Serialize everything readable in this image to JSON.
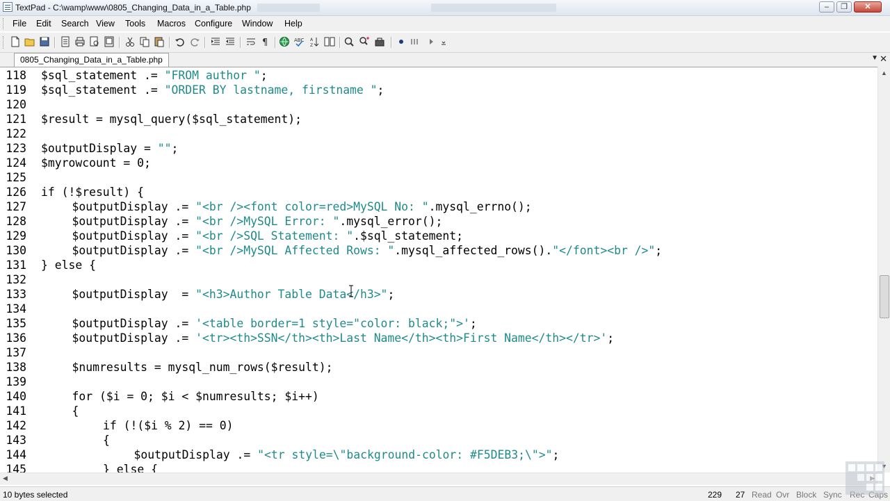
{
  "window": {
    "title": "TextPad - C:\\wamp\\www\\0805_Changing_Data_in_a_Table.php",
    "controls": [
      "minimize",
      "restore",
      "close"
    ]
  },
  "menu": [
    "File",
    "Edit",
    "Search",
    "View",
    "Tools",
    "Macros",
    "Configure",
    "Window",
    "Help"
  ],
  "toolbar_icons": [
    "new-file-icon",
    "open-folder-icon",
    "save-icon",
    "save-all-icon",
    "print-icon",
    "print-preview-icon",
    "cut-icon",
    "copy-icon",
    "paste-icon",
    "undo-icon",
    "redo-icon",
    "indent-icon",
    "outdent-icon",
    "word-wrap-icon",
    "pilcrow-icon",
    "web-icon",
    "spell-check-icon",
    "sort-icon",
    "compare-icon",
    "find-icon",
    "find-replace-icon",
    "tools-icon",
    "record-macro-icon",
    "play-macro-icon",
    "step-icon"
  ],
  "doc_tab": {
    "label": "0805_Changing_Data_in_a_Table.php"
  },
  "editor": {
    "lines": [
      {
        "n": "118",
        "indent": 0,
        "segments": [
          {
            "t": "$sql_statement .= ",
            "c": "code"
          },
          {
            "t": "\"FROM author \"",
            "c": "str"
          },
          {
            "t": ";",
            "c": "code"
          }
        ]
      },
      {
        "n": "119",
        "indent": 0,
        "segments": [
          {
            "t": "$sql_statement .= ",
            "c": "code"
          },
          {
            "t": "\"ORDER BY lastname, firstname \"",
            "c": "str"
          },
          {
            "t": ";",
            "c": "code"
          }
        ]
      },
      {
        "n": "120",
        "indent": 0,
        "segments": []
      },
      {
        "n": "121",
        "indent": 0,
        "segments": [
          {
            "t": "$result = mysql_query($sql_statement);",
            "c": "code"
          }
        ]
      },
      {
        "n": "122",
        "indent": 0,
        "segments": []
      },
      {
        "n": "123",
        "indent": 0,
        "segments": [
          {
            "t": "$outputDisplay = ",
            "c": "code"
          },
          {
            "t": "\"\"",
            "c": "str"
          },
          {
            "t": ";",
            "c": "code"
          }
        ]
      },
      {
        "n": "124",
        "indent": 0,
        "segments": [
          {
            "t": "$myrowcount = 0;",
            "c": "code"
          }
        ]
      },
      {
        "n": "125",
        "indent": 0,
        "segments": []
      },
      {
        "n": "126",
        "indent": 0,
        "segments": [
          {
            "t": "if (!$result) {",
            "c": "code"
          }
        ]
      },
      {
        "n": "127",
        "indent": 1,
        "segments": [
          {
            "t": "$outputDisplay .= ",
            "c": "code"
          },
          {
            "t": "\"<br /><font color=red>MySQL No: \"",
            "c": "str"
          },
          {
            "t": ".mysql_errno();",
            "c": "code"
          }
        ]
      },
      {
        "n": "128",
        "indent": 1,
        "segments": [
          {
            "t": "$outputDisplay .= ",
            "c": "code"
          },
          {
            "t": "\"<br />MySQL Error: \"",
            "c": "str"
          },
          {
            "t": ".mysql_error();",
            "c": "code"
          }
        ]
      },
      {
        "n": "129",
        "indent": 1,
        "segments": [
          {
            "t": "$outputDisplay .= ",
            "c": "code"
          },
          {
            "t": "\"<br />SQL Statement: \"",
            "c": "str"
          },
          {
            "t": ".$sql_statement;",
            "c": "code"
          }
        ]
      },
      {
        "n": "130",
        "indent": 1,
        "segments": [
          {
            "t": "$outputDisplay .= ",
            "c": "code"
          },
          {
            "t": "\"<br />MySQL Affected Rows: \"",
            "c": "str"
          },
          {
            "t": ".mysql_affected_rows().",
            "c": "code"
          },
          {
            "t": "\"</font><br />\"",
            "c": "str"
          },
          {
            "t": ";",
            "c": "code"
          }
        ]
      },
      {
        "n": "131",
        "indent": 0,
        "segments": [
          {
            "t": "} else {",
            "c": "code"
          }
        ]
      },
      {
        "n": "132",
        "indent": 0,
        "segments": []
      },
      {
        "n": "133",
        "indent": 1,
        "segments": [
          {
            "t": "$outputDisplay  = ",
            "c": "code"
          },
          {
            "t": "\"<h3>Author Table Data</h3>\"",
            "c": "str"
          },
          {
            "t": ";",
            "c": "code"
          }
        ]
      },
      {
        "n": "134",
        "indent": 0,
        "segments": []
      },
      {
        "n": "135",
        "indent": 1,
        "segments": [
          {
            "t": "$outputDisplay .= ",
            "c": "code"
          },
          {
            "t": "'<table border=1 style=\"color: black;\">'",
            "c": "str"
          },
          {
            "t": ";",
            "c": "code"
          }
        ]
      },
      {
        "n": "136",
        "indent": 1,
        "segments": [
          {
            "t": "$outputDisplay .= ",
            "c": "code"
          },
          {
            "t": "'<tr><th>SSN</th><th>Last Name</th><th>First Name</th></tr>'",
            "c": "str"
          },
          {
            "t": ";",
            "c": "code"
          }
        ]
      },
      {
        "n": "137",
        "indent": 0,
        "segments": []
      },
      {
        "n": "138",
        "indent": 1,
        "segments": [
          {
            "t": "$numresults = mysql_num_rows($result);",
            "c": "code"
          }
        ]
      },
      {
        "n": "139",
        "indent": 0,
        "segments": []
      },
      {
        "n": "140",
        "indent": 1,
        "segments": [
          {
            "t": "for ($i = 0; $i < $numresults; $i++)",
            "c": "code"
          }
        ]
      },
      {
        "n": "141",
        "indent": 1,
        "segments": [
          {
            "t": "{",
            "c": "code"
          }
        ]
      },
      {
        "n": "142",
        "indent": 2,
        "segments": [
          {
            "t": "if (!($i % 2) == 0)",
            "c": "code"
          }
        ]
      },
      {
        "n": "143",
        "indent": 2,
        "segments": [
          {
            "t": "{",
            "c": "code"
          }
        ]
      },
      {
        "n": "144",
        "indent": 3,
        "segments": [
          {
            "t": "$outputDisplay .= ",
            "c": "code"
          },
          {
            "t": "\"<tr style=\\\"background-color: #F5DEB3;\\\">\"",
            "c": "str"
          },
          {
            "t": ";",
            "c": "code"
          }
        ]
      },
      {
        "n": "145",
        "indent": 2,
        "segments": [
          {
            "t": "} else {",
            "c": "code"
          }
        ]
      }
    ],
    "string_color": "#1f8a8a"
  },
  "status": {
    "message": "10 bytes selected",
    "line": "229",
    "col": "27",
    "read": "Read",
    "ovr": "Ovr",
    "block": "Block",
    "sync": "Sync",
    "rec": "Rec",
    "caps": "Caps"
  }
}
